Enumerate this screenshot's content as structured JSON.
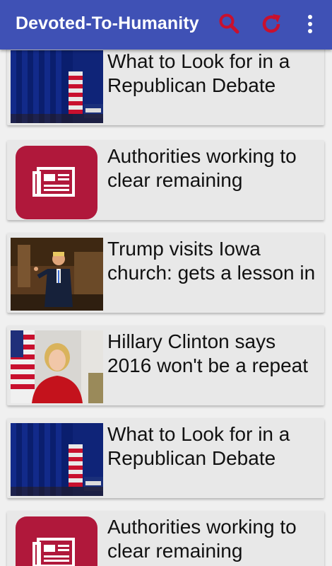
{
  "app": {
    "title": "Devoted-To-Humanity",
    "colors": {
      "toolbar": "#3f51b5",
      "action_icons": "#c8102e",
      "placeholder_tile": "#b0183b"
    },
    "actions": [
      {
        "name": "search",
        "icon": "search-icon"
      },
      {
        "name": "refresh",
        "icon": "refresh-icon"
      },
      {
        "name": "more",
        "icon": "more-vert-icon"
      }
    ]
  },
  "articles": [
    {
      "title": "What to Look for in a Republican Debate",
      "thumbnail": "debate-stage-photo"
    },
    {
      "title": "Authorities working to clear remaining",
      "thumbnail": "newspaper-icon"
    },
    {
      "title": "Trump visits Iowa church: gets a lesson in",
      "thumbnail": "trump-photo"
    },
    {
      "title": "Hillary Clinton says 2016 won't be a repeat",
      "thumbnail": "clinton-photo"
    },
    {
      "title": "What to Look for in a Republican Debate",
      "thumbnail": "debate-stage-photo"
    },
    {
      "title": "Authorities working to clear remaining",
      "thumbnail": "newspaper-icon"
    }
  ]
}
